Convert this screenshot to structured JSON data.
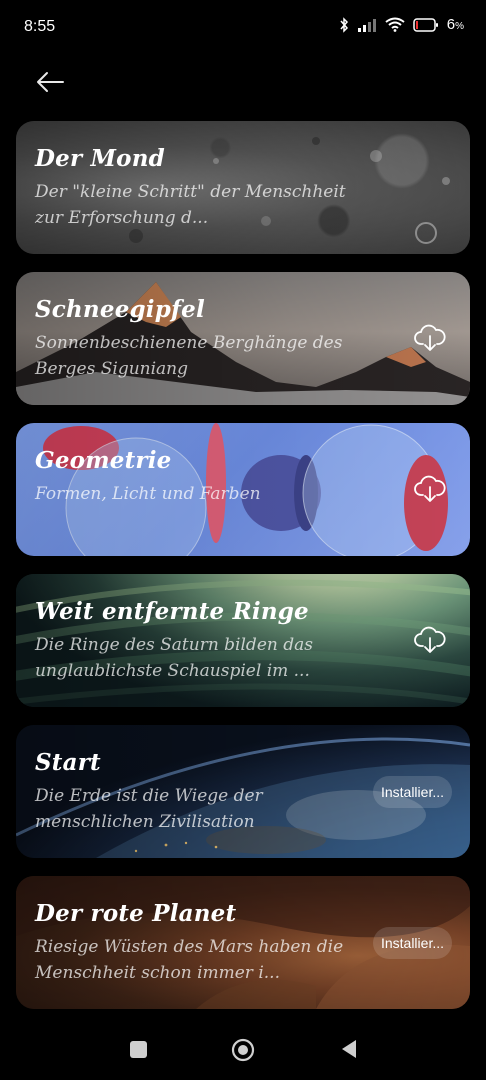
{
  "status_bar": {
    "time": "8:55",
    "battery": "6"
  },
  "cards": [
    {
      "title": "Der Mond",
      "description": "Der \"kleine Schritt\" der Menschheit zur Erforschung d...",
      "action": "none"
    },
    {
      "title": "Schneegipfel",
      "description": "Sonnenbeschienene Berghänge des Berges Siguniang",
      "action": "download-icon"
    },
    {
      "title": "Geometrie",
      "description": "Formen, Licht und Farben",
      "action": "download-icon"
    },
    {
      "title": "Weit entfernte Ringe",
      "description": "Die Ringe des Saturn bilden das unglaublichste Schauspiel im ...",
      "action": "download-icon"
    },
    {
      "title": "Start",
      "description": "Die Erde ist die Wiege der menschlichen Zivilisation",
      "action_label": "Installier..."
    },
    {
      "title": "Der rote Planet",
      "description": "Riesige Wüsten des Mars haben die Menschheit schon immer i...",
      "action_label": "Installier..."
    }
  ],
  "icons": {
    "back": "back-arrow-icon",
    "download": "cloud-download-icon",
    "bluetooth": "bluetooth-icon",
    "signal": "signal-icon",
    "wifi": "wifi-icon",
    "battery": "battery-icon"
  }
}
